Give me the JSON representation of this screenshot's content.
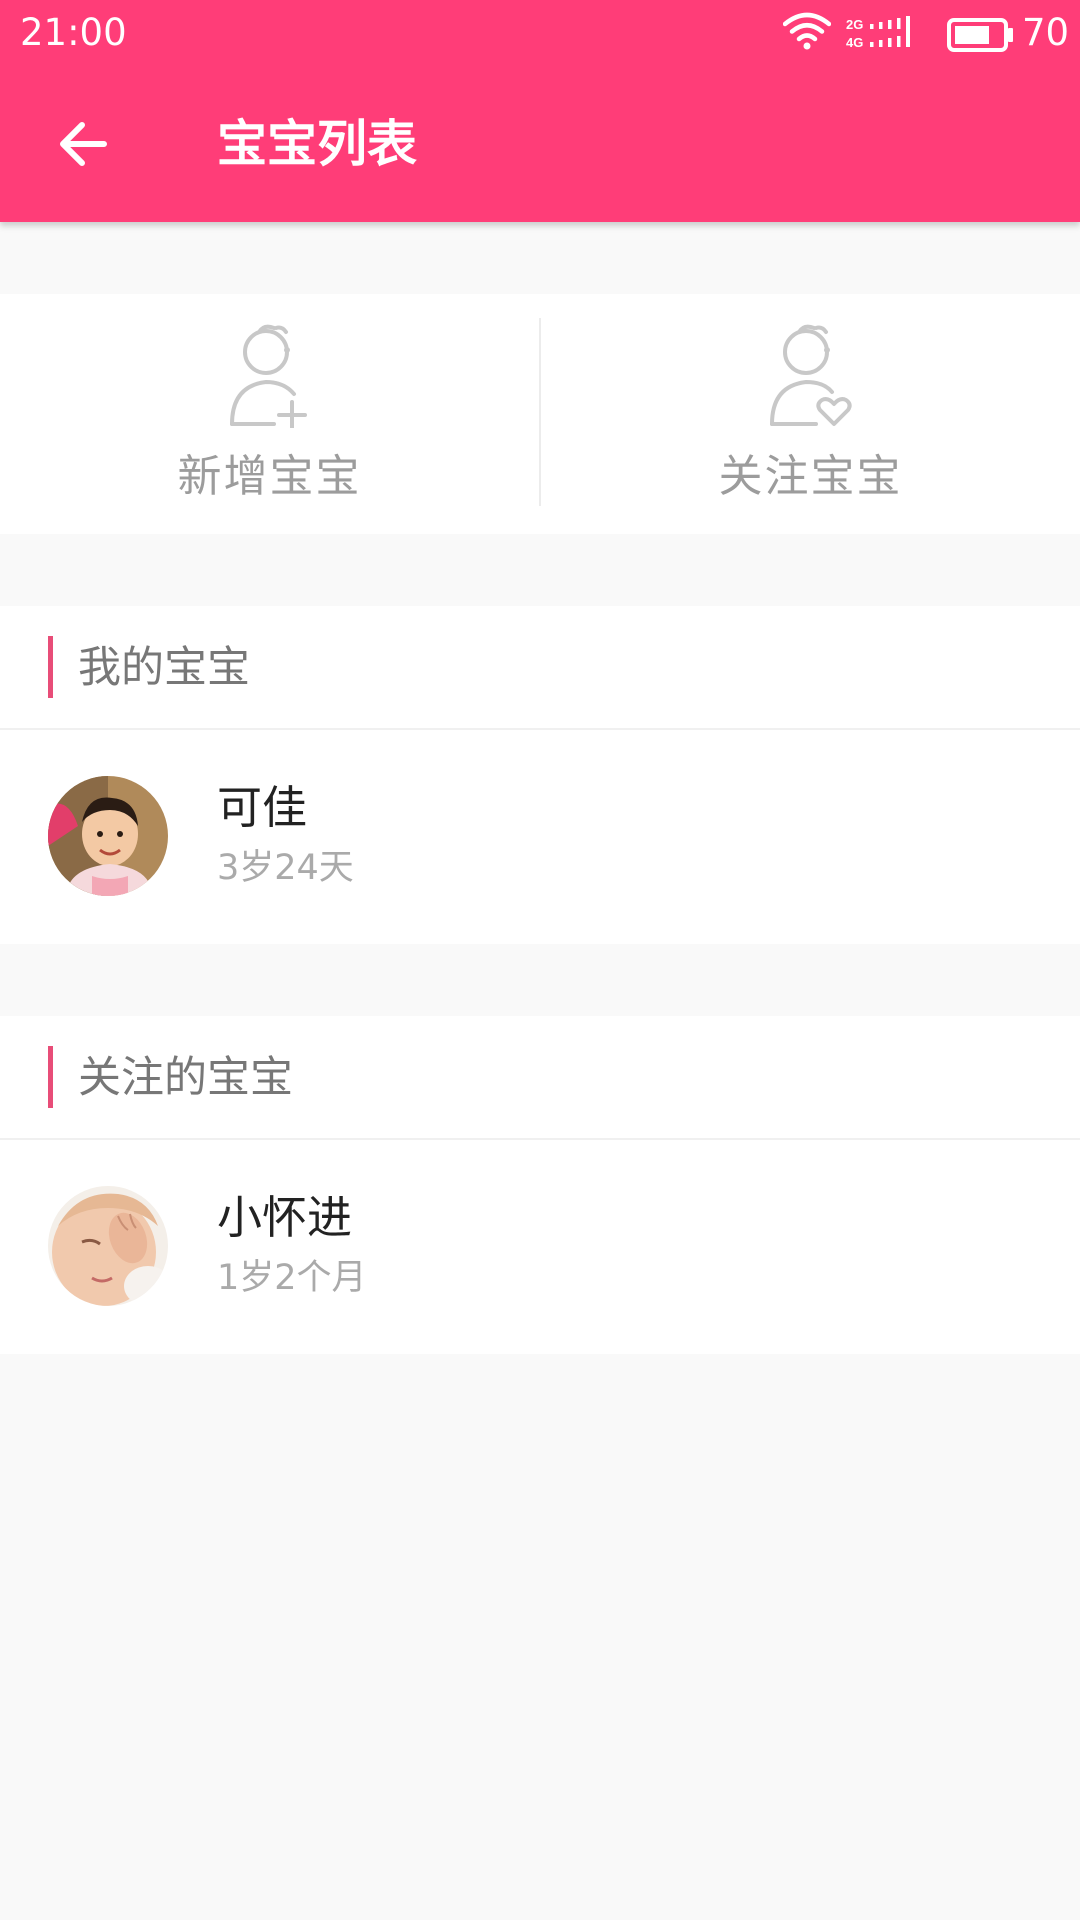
{
  "status_bar": {
    "time": "21:00",
    "network_labels": [
      "2G",
      "4G"
    ],
    "battery_level": "70"
  },
  "header": {
    "title": "宝宝列表",
    "back_icon": "arrow-left-icon",
    "background_color": "#ff3d78"
  },
  "actions": [
    {
      "label": "新增宝宝",
      "icon": "add-baby-icon"
    },
    {
      "label": "关注宝宝",
      "icon": "follow-baby-icon"
    }
  ],
  "sections": [
    {
      "title": "我的宝宝",
      "items": [
        {
          "name": "可佳",
          "age": "3岁24天"
        }
      ]
    },
    {
      "title": "关注的宝宝",
      "items": [
        {
          "name": "小怀进",
          "age": "1岁2个月"
        }
      ]
    }
  ],
  "colors": {
    "accent": "#e84d78",
    "icon_gray": "#c8c8c8",
    "label_gray": "#9c9c9c"
  }
}
